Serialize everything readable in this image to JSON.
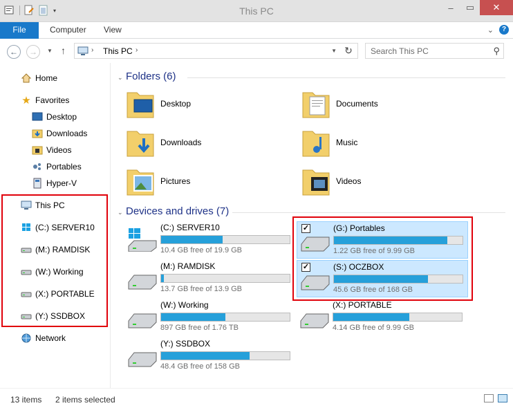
{
  "window": {
    "title": "This PC"
  },
  "ribbon": {
    "tabs": [
      "File",
      "Computer",
      "View"
    ]
  },
  "address": {
    "path": "This PC",
    "search_placeholder": "Search This PC"
  },
  "nav": {
    "home": "Home",
    "favorites": "Favorites",
    "favorite_items": [
      "Desktop",
      "Downloads",
      "Videos",
      "Portables",
      "Hyper-V"
    ],
    "this_pc": "This PC",
    "drives": [
      "(C:) SERVER10",
      "(M:) RAMDISK",
      "(W:) Working",
      "(X:) PORTABLE",
      "(Y:) SSDBOX"
    ],
    "network": "Network"
  },
  "folders_group": {
    "title": "Folders (6)"
  },
  "folders": [
    "Desktop",
    "Documents",
    "Downloads",
    "Music",
    "Pictures",
    "Videos"
  ],
  "drives_group": {
    "title": "Devices and drives (7)"
  },
  "drives": [
    {
      "name": "(C:) SERVER10",
      "free": "10.4 GB free of 19.9 GB",
      "used_fraction": 0.48,
      "selected": false
    },
    {
      "name": "(G:) Portables",
      "free": "1.22 GB free of 9.99 GB",
      "used_fraction": 0.88,
      "selected": true
    },
    {
      "name": "(M:) RAMDISK",
      "free": "13.7 GB free of 13.9 GB",
      "used_fraction": 0.02,
      "selected": false
    },
    {
      "name": "(S:) OCZBOX",
      "free": "45.6 GB free of 168 GB",
      "used_fraction": 0.73,
      "selected": true
    },
    {
      "name": "(W:) Working",
      "free": "897 GB free of 1.76 TB",
      "used_fraction": 0.5,
      "selected": false
    },
    {
      "name": "(X:) PORTABLE",
      "free": "4.14 GB free of 9.99 GB",
      "used_fraction": 0.59,
      "selected": false
    },
    {
      "name": "(Y:) SSDBOX",
      "free": "48.4 GB free of 158 GB",
      "used_fraction": 0.69,
      "selected": false
    }
  ],
  "status": {
    "items": "13 items",
    "selected": "2 items selected"
  },
  "colors": {
    "accent": "#1979ca",
    "bar_fill": "#26a0da",
    "highlight_box": "#e0000a",
    "selection": "#cce8ff"
  }
}
